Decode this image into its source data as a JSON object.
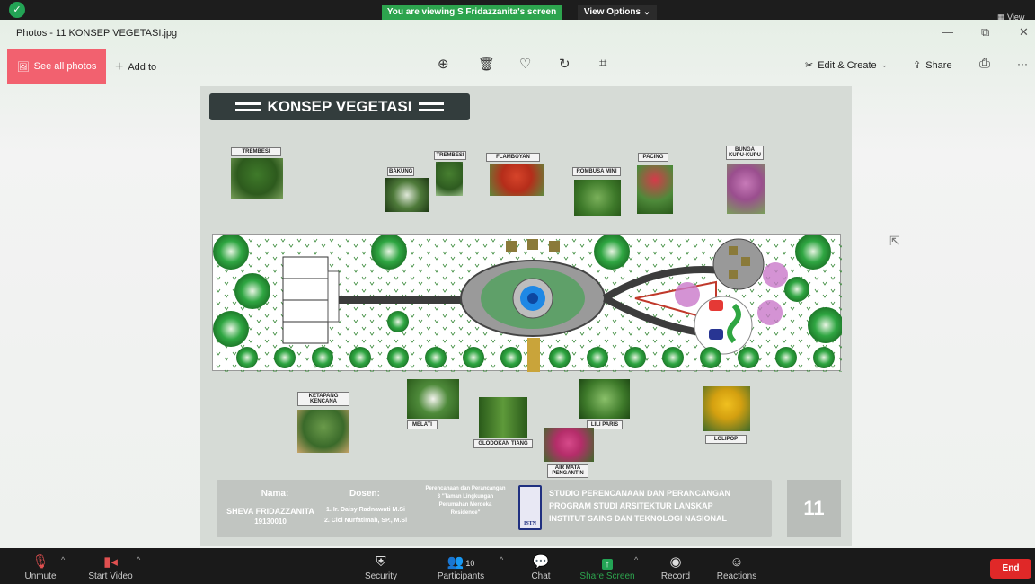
{
  "zoom": {
    "banner": "You are viewing S Fridazzanita's screen",
    "view_options": "View Options ⌄",
    "view_corner": "▦ View"
  },
  "photos": {
    "title": "Photos - 11 KONSEP VEGETASI.jpg",
    "see_all": "See all photos",
    "add_to": "Add to",
    "edit_create": "Edit & Create",
    "share": "Share",
    "more": "···",
    "min": "—",
    "restore": "⧉",
    "close": "✕"
  },
  "poster": {
    "title": "KONSEP VEGETASI",
    "plants_top": [
      "TREMBESI",
      "BAKUNG",
      "TREMBESI",
      "FLAMBOYAN",
      "ROMBUSA MINI",
      "PACING",
      "BUNGA KUPU-KUPU"
    ],
    "plants_bottom": [
      "KETAPANG KENCANA",
      "MELATI",
      "GLODOKAN TIANG",
      "LILI PARIS",
      "LOLIPOP",
      "AIR MATA PENGANTIN"
    ],
    "footer": {
      "nama_label": "Nama:",
      "nama": "SHEVA FRIDAZZANITA",
      "nim": "19130010",
      "dosen_label": "Dosen:",
      "dosen1": "1. Ir. Daisy Radnawati M.Si",
      "dosen2": "2. Cici Nurfatimah, SP., M.Si",
      "course": "Perencanaan dan Perancangan 3 \"Taman Lingkungan Perumahan Merdeka Residence\"",
      "logo": "ISTN",
      "studio1": "STUDIO PERENCANAAN DAN PERANCANGAN",
      "studio2": "PROGRAM STUDI ARSITEKTUR LANSKAP",
      "studio3": "INSTITUT SAINS DAN TEKNOLOGI NASIONAL",
      "page": "11"
    }
  },
  "meeting": {
    "unmute": "Unmute",
    "start_video": "Start Video",
    "security": "Security",
    "participants": "Participants",
    "participants_count": "10",
    "chat": "Chat",
    "share_screen": "Share Screen",
    "record": "Record",
    "reactions": "Reactions",
    "end": "End"
  },
  "colors": {
    "accent": "#f2616f",
    "green": "#2da44e",
    "end": "#e02828"
  }
}
